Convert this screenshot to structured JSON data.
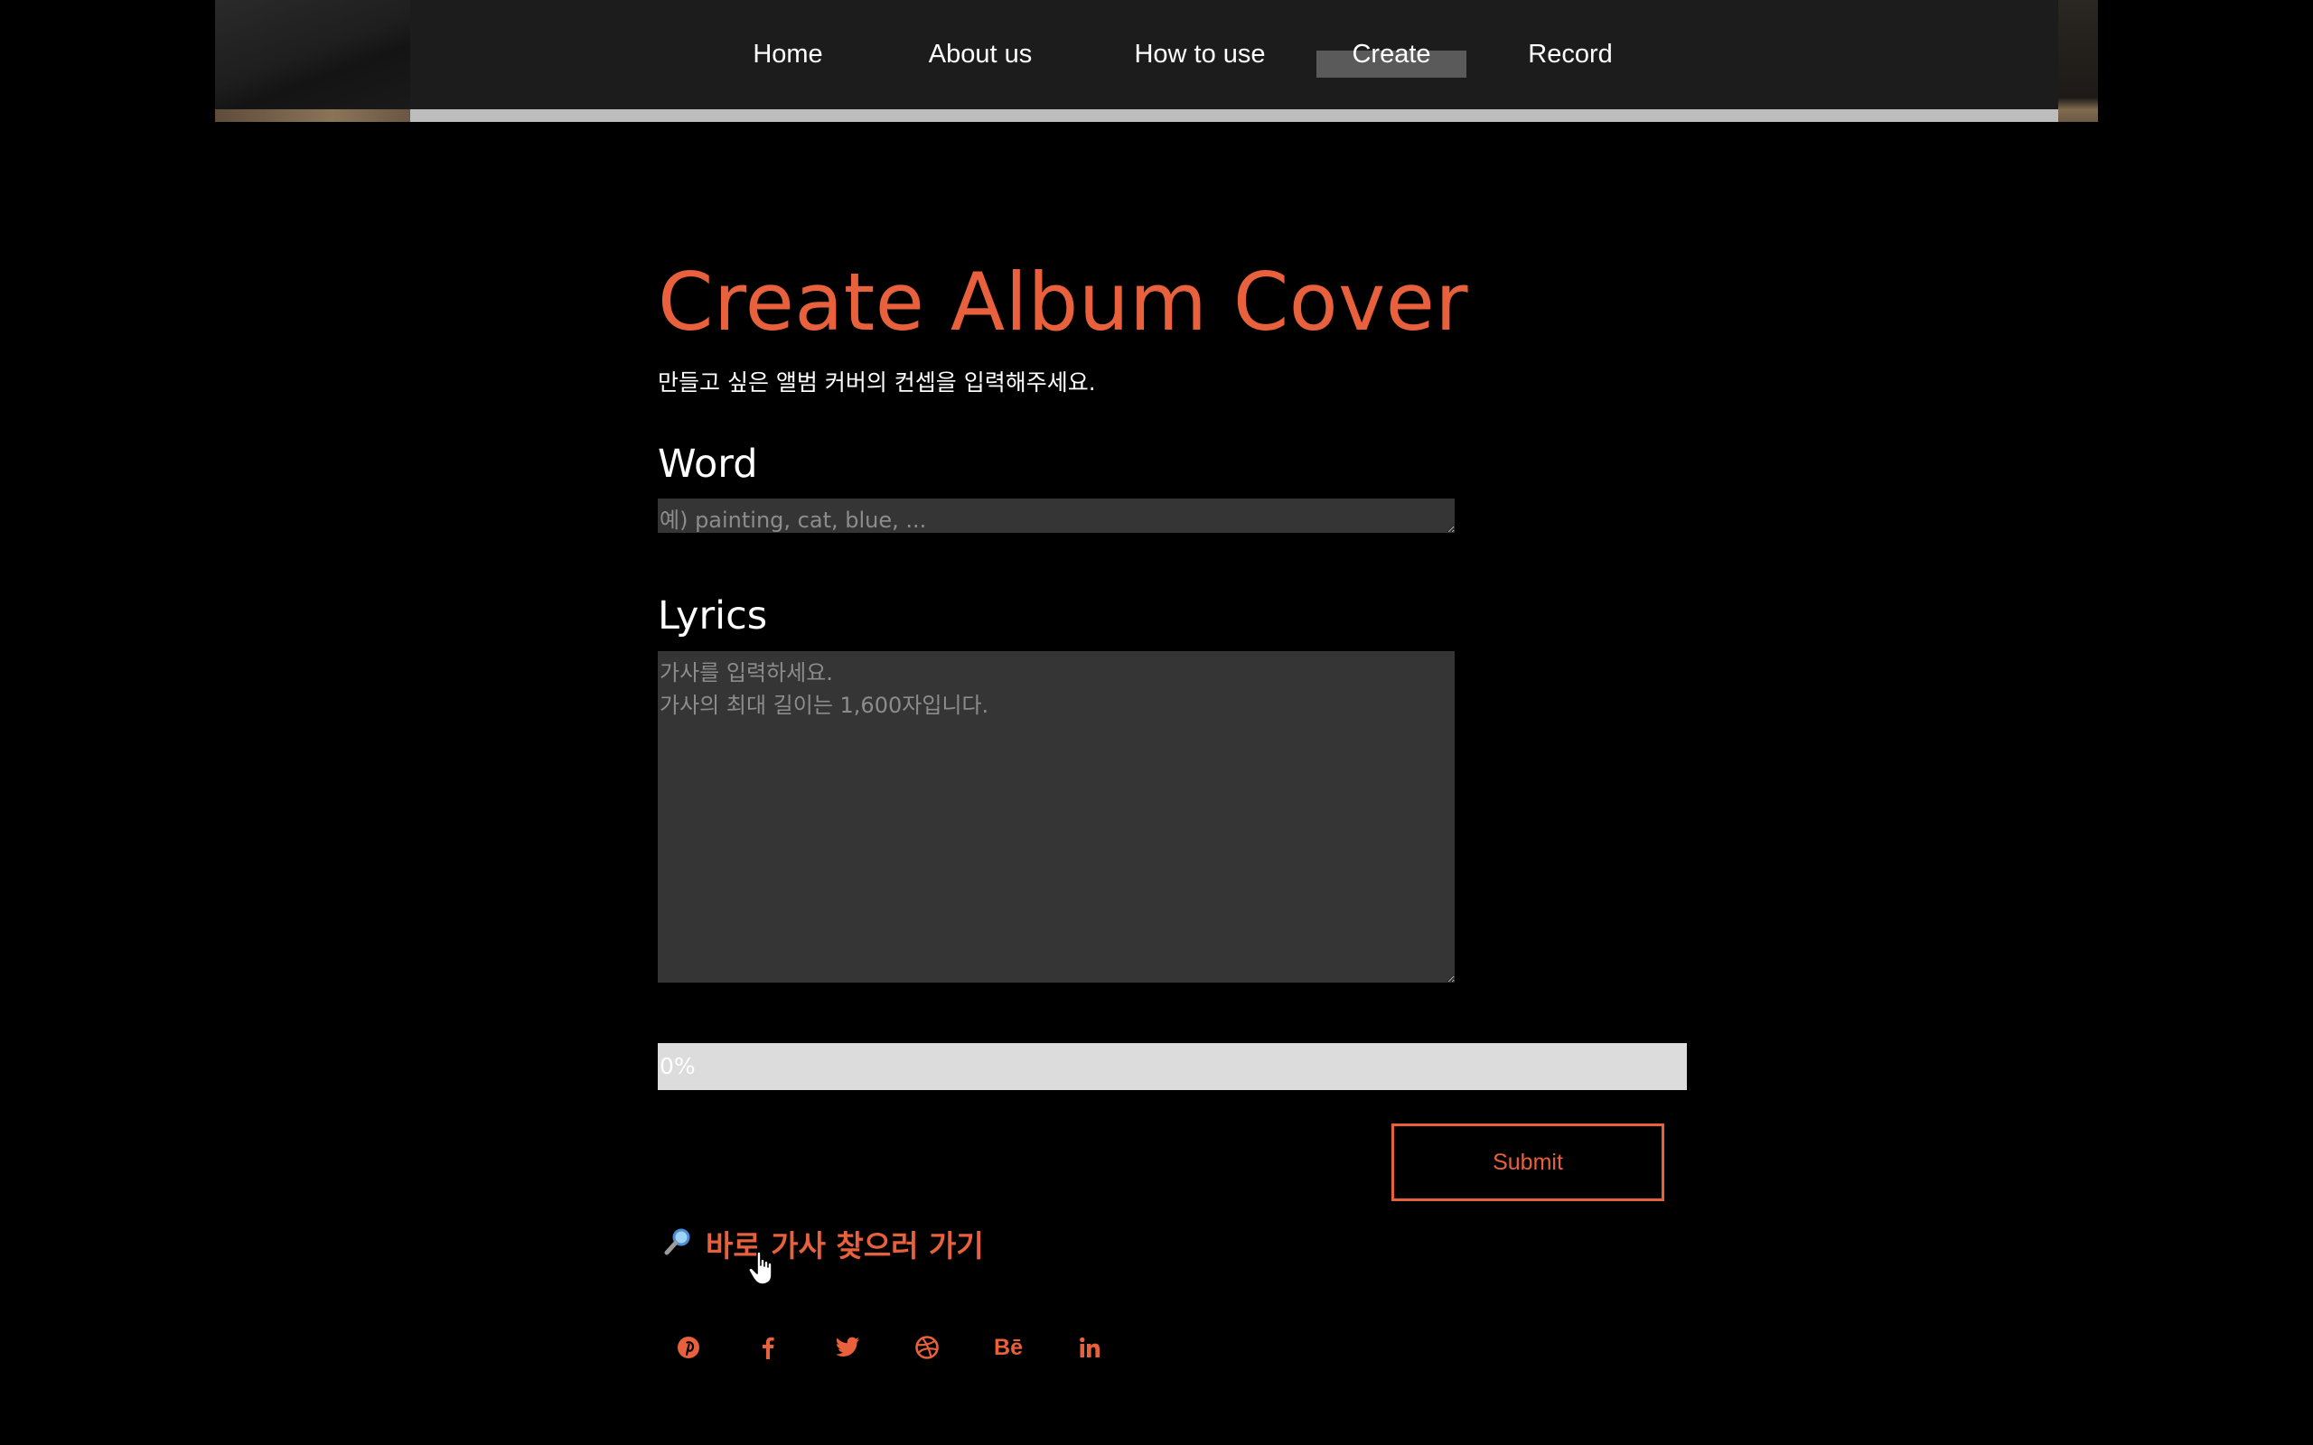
{
  "nav": {
    "items": [
      {
        "label": "Home"
      },
      {
        "label": "About us"
      },
      {
        "label": "How to use"
      },
      {
        "label": "Create",
        "active": true
      },
      {
        "label": "Record"
      }
    ]
  },
  "main": {
    "title": "Create Album Cover",
    "subtitle": "만들고 싶은 앨범 커버의 컨셉을 입력해주세요.",
    "word": {
      "label": "Word",
      "value": "",
      "placeholder": "예) painting, cat, blue, ..."
    },
    "lyrics": {
      "label": "Lyrics",
      "value": "",
      "placeholder": "가사를 입력하세요.\n가사의 최대 길이는 1,600자입니다."
    },
    "progress": {
      "value": 0,
      "text": "0%"
    },
    "submit_label": "Submit",
    "lyrics_link": {
      "icon": "magnifier-icon",
      "text": "바로 가사 찾으러 가기"
    }
  },
  "social": {
    "icons": [
      "pinterest-icon",
      "facebook-icon",
      "twitter-icon",
      "dribbble-icon",
      "behance-icon",
      "linkedin-icon"
    ],
    "behance_text": "Bē"
  },
  "colors": {
    "accent": "#e8603c",
    "background": "#000000",
    "header": "#1c1c1c",
    "field": "#353535",
    "progress_track": "#dcdcdc"
  }
}
